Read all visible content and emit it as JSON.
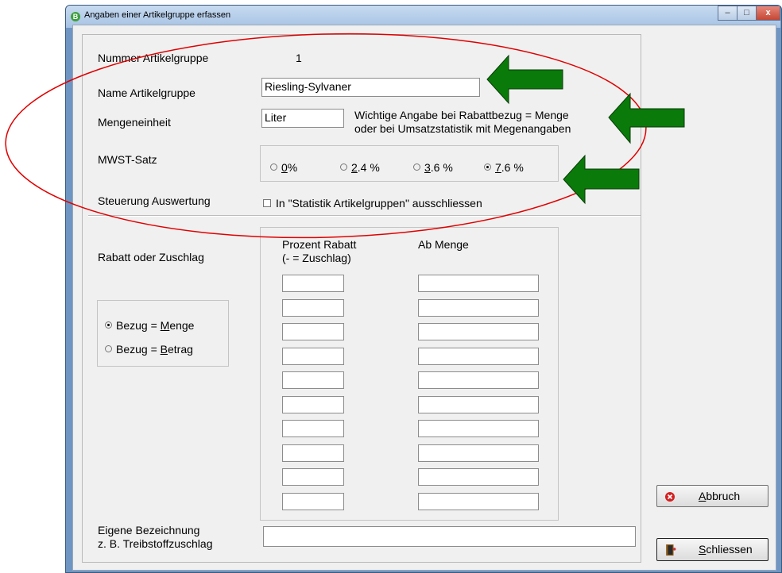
{
  "window": {
    "title": "Angaben einer Artikelgruppe erfassen",
    "app_icon": "B"
  },
  "titlebar_buttons": {
    "minimize": "–",
    "maximize": "□",
    "close": "x"
  },
  "form": {
    "nummer_label": "Nummer Artikelgruppe",
    "nummer_value": "1",
    "name_label": "Name Artikelgruppe",
    "name_value": "Riesling-Sylvaner",
    "einheit_label": "Mengeneinheit",
    "einheit_value": "Liter",
    "einheit_hint_1": "Wichtige Angabe bei Rabattbezug = Menge",
    "einheit_hint_2": "oder bei Umsatzstatistik mit Megenangaben",
    "mwst_label": "MWST-Satz",
    "mwst_options": [
      {
        "prefix": "",
        "underline": "0",
        "suffix": "%",
        "selected": false
      },
      {
        "prefix": "",
        "underline": "2",
        "suffix": ".4 %",
        "selected": false
      },
      {
        "prefix": "",
        "underline": "3",
        "suffix": ".6 %",
        "selected": false
      },
      {
        "prefix": "",
        "underline": "7",
        "suffix": ".6 %",
        "selected": true
      }
    ],
    "steuerung_label": "Steuerung Auswertung",
    "statistik_checkbox": "In \"Statistik Artikelgruppen\" ausschliessen",
    "rabatt_label": "Rabatt oder Zuschlag",
    "col_prozent_1": "Prozent Rabatt",
    "col_prozent_2": "(- = Zuschlag)",
    "col_menge": "Ab Menge",
    "bezug_menge_prefix": "Bezug = ",
    "bezug_menge_ul": "M",
    "bezug_menge_rest": "enge",
    "bezug_betrag_prefix": "Bezug = ",
    "bezug_betrag_ul": "B",
    "bezug_betrag_rest": "etrag",
    "eigene_label_1": "Eigene Bezeichnung",
    "eigene_label_2": "z. B. Treibstoffzuschlag",
    "eigene_value": ""
  },
  "buttons": {
    "abbruch_ul": "A",
    "abbruch_rest": "bbruch",
    "schliessen_ul": "S",
    "schliessen_rest": "chliessen"
  },
  "colors": {
    "annotation_ellipse": "#e00000",
    "arrow_fill": "#0a7a0a",
    "window_border": "#6f95c2"
  }
}
